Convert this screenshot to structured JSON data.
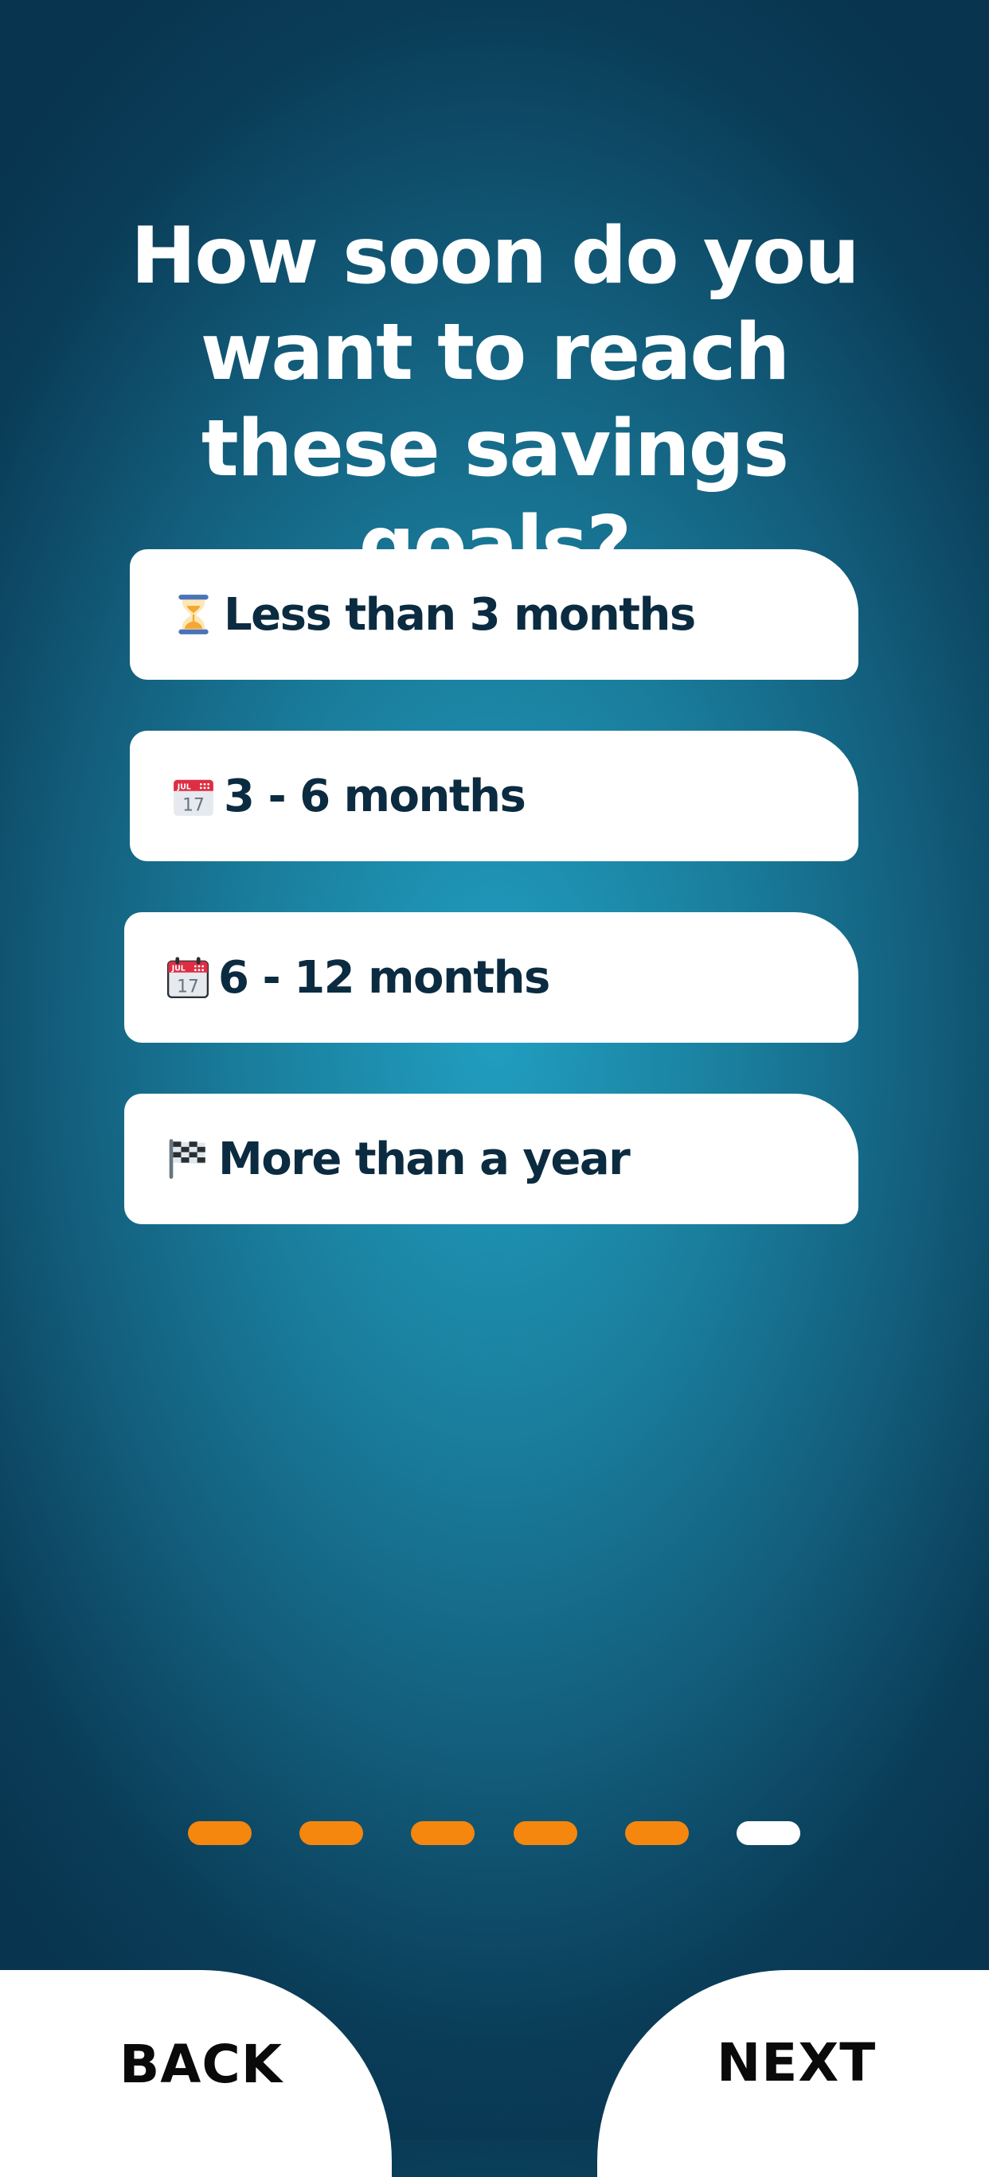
{
  "question": {
    "title": "How soon do you want to reach these savings goals?"
  },
  "options": [
    {
      "label": "Less than 3 months",
      "icon": "hourglass-icon"
    },
    {
      "label": "3 - 6 months",
      "icon": "calendar-icon"
    },
    {
      "label": "6 - 12 months",
      "icon": "calendar-icon"
    },
    {
      "label": "More than a year",
      "icon": "checkered-flag-icon"
    }
  ],
  "progress": {
    "total_steps": 6,
    "current_step": 6,
    "completed_color": "#f5860e",
    "current_color": "#ffffff"
  },
  "navigation": {
    "back_label": "BACK",
    "next_label": "NEXT"
  },
  "colors": {
    "background_center": "#219ec0",
    "background_edge": "#08344f",
    "option_text": "#0b2b40"
  }
}
